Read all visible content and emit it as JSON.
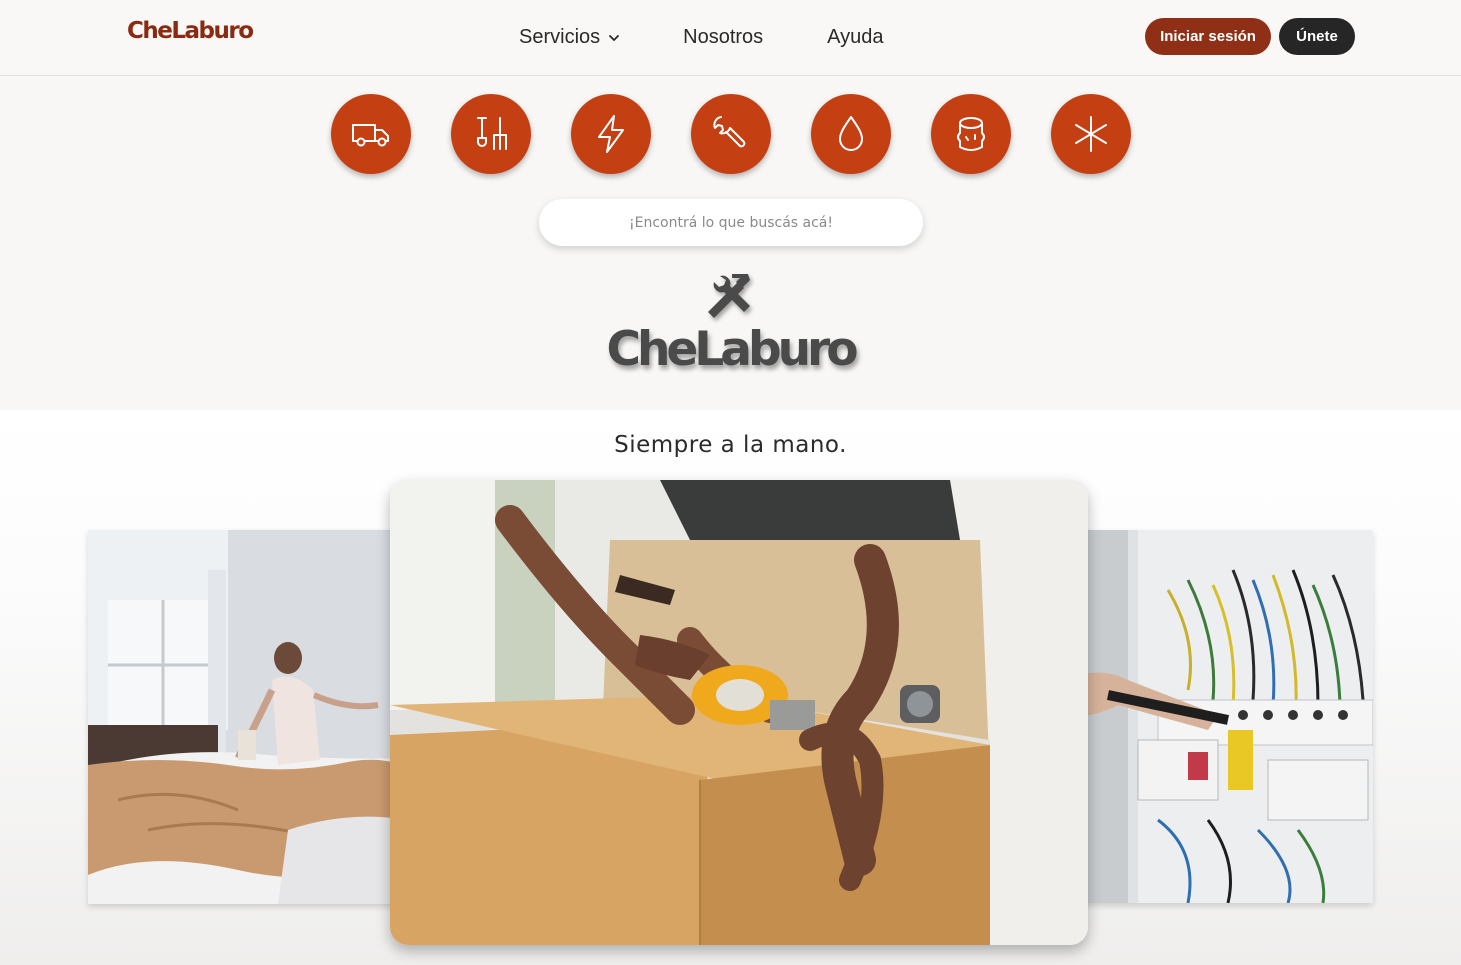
{
  "header": {
    "brand": "CheLaburo",
    "nav": [
      {
        "label": "Servicios",
        "has_dropdown": true
      },
      {
        "label": "Nosotros"
      },
      {
        "label": "Ayuda"
      }
    ],
    "login_label": "Iniciar sesión",
    "join_label": "Únete"
  },
  "services": [
    {
      "icon": "truck-icon"
    },
    {
      "icon": "garden-tools-icon"
    },
    {
      "icon": "lightning-icon"
    },
    {
      "icon": "wrench-icon"
    },
    {
      "icon": "water-drop-icon"
    },
    {
      "icon": "tree-stump-icon"
    },
    {
      "icon": "snowflake-icon"
    }
  ],
  "search": {
    "placeholder": "¡Encontrá lo que buscás acá!",
    "value": ""
  },
  "hero": {
    "logo_text": "CheLaburo",
    "tagline": "Siempre a la mano."
  },
  "gallery": [
    {
      "name": "cleaning-photo",
      "subject": "woman making a bed"
    },
    {
      "name": "moving-photo",
      "subject": "man taping a cardboard box"
    },
    {
      "name": "electrical-photo",
      "subject": "electrical panel wiring"
    }
  ],
  "colors": {
    "accent": "#c43f12",
    "brand": "#8a2a12",
    "login_button": "#8f2f16",
    "join_button": "#262626",
    "background": "#f8f7f5"
  }
}
